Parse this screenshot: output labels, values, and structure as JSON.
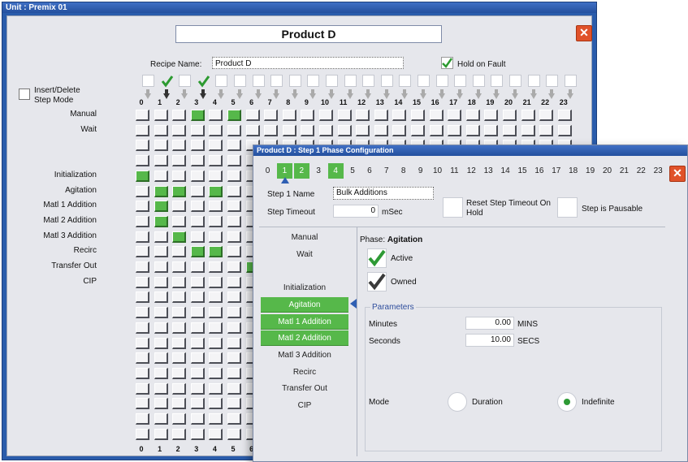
{
  "main_window": {
    "title": "Unit : Premix 01",
    "product_title": "Product D",
    "close_glyph": "✕",
    "recipe_label": "Recipe Name:",
    "recipe_value": "Product D",
    "hold_on_fault_label": "Hold on Fault",
    "hold_on_fault_checked": true,
    "insert_delete_label": "Insert/Delete Step Mode",
    "step_numbers": [
      "0",
      "1",
      "2",
      "3",
      "4",
      "5",
      "6",
      "7",
      "8",
      "9",
      "10",
      "11",
      "12",
      "13",
      "14",
      "15",
      "16",
      "17",
      "18",
      "19",
      "20",
      "21",
      "22",
      "23"
    ],
    "top_step_checks": [
      false,
      true,
      false,
      true,
      false,
      false,
      false,
      false,
      false,
      false,
      false,
      false,
      false,
      false,
      false,
      false,
      false,
      false,
      false,
      false,
      false,
      false,
      false,
      false
    ],
    "phases": [
      "Manual",
      "Wait",
      "",
      "",
      "Initialization",
      "Agitation",
      "Matl 1 Addition",
      "Matl 2 Addition",
      "Matl 3 Addition",
      "Recirc",
      "Transfer Out",
      "CIP"
    ],
    "active_cells": [
      {
        "row": 0,
        "step": 3
      },
      {
        "row": 0,
        "step": 5
      },
      {
        "row": 4,
        "step": 0
      },
      {
        "row": 5,
        "step": 1
      },
      {
        "row": 5,
        "step": 2
      },
      {
        "row": 5,
        "step": 4
      },
      {
        "row": 6,
        "step": 1
      },
      {
        "row": 7,
        "step": 1
      },
      {
        "row": 8,
        "step": 2
      },
      {
        "row": 9,
        "step": 3
      },
      {
        "row": 9,
        "step": 4
      },
      {
        "row": 10,
        "step": 6
      }
    ]
  },
  "popup": {
    "title": "Product D : Step 1 Phase Configuration",
    "close_glyph": "✕",
    "tabs": [
      "0",
      "1",
      "2",
      "3",
      "4",
      "5",
      "6",
      "7",
      "8",
      "9",
      "10",
      "11",
      "12",
      "13",
      "14",
      "15",
      "16",
      "17",
      "18",
      "19",
      "20",
      "21",
      "22",
      "23"
    ],
    "selected_tab": 1,
    "highlighted_tabs": [
      1,
      2,
      4
    ],
    "step_name_label": "Step 1 Name",
    "step_name_value": "Bulk Additions",
    "step_timeout_label": "Step Timeout",
    "step_timeout_value": "0",
    "step_timeout_unit": "mSec",
    "reset_timeout_label": "Reset Step Timeout On Hold",
    "pausable_label": "Step is Pausable",
    "phase_list": [
      "Manual",
      "Wait",
      "",
      "Initialization",
      "Agitation",
      "Matl 1 Addition",
      "Matl 2 Addition",
      "Matl 3 Addition",
      "Recirc",
      "Transfer Out",
      "CIP"
    ],
    "green_phases": [
      4,
      5,
      6
    ],
    "phase_prefix": "Phase:",
    "phase_name": "Agitation",
    "active_label": "Active",
    "owned_label": "Owned",
    "parameters_label": "Parameters",
    "minutes_label": "Minutes",
    "minutes_value": "0.00",
    "minutes_unit": "MINS",
    "seconds_label": "Seconds",
    "seconds_value": "10.00",
    "seconds_unit": "SECS",
    "mode_label": "Mode",
    "duration_label": "Duration",
    "indefinite_label": "Indefinite",
    "mode_selected": "indefinite",
    "colors": {
      "green": "#56b84a",
      "title_bar": "#2a5cab",
      "close": "#e0522a"
    }
  }
}
